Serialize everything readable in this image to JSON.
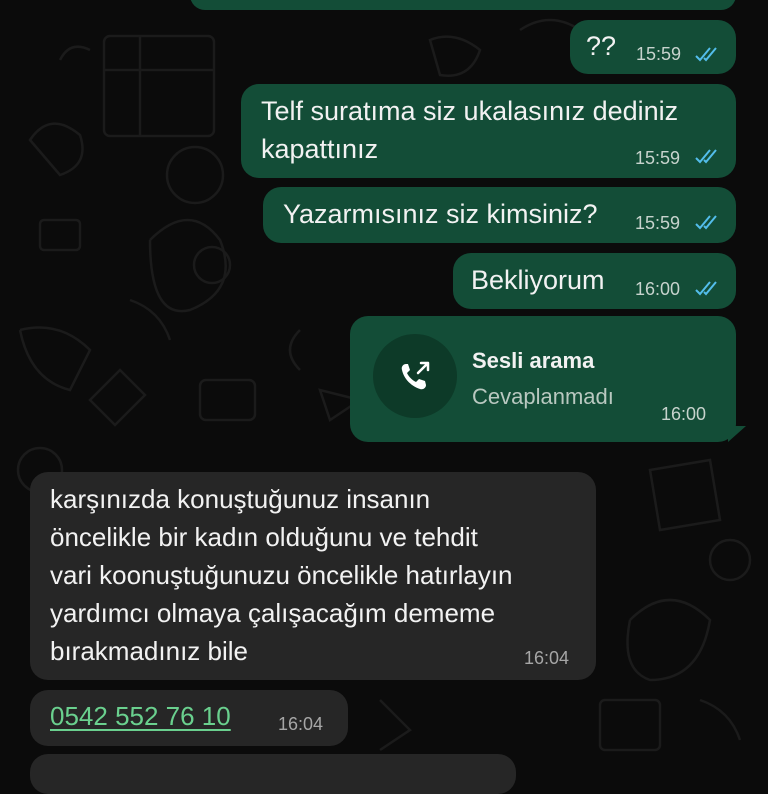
{
  "chat": {
    "messages": [
      {
        "text": "??",
        "time": "15:59",
        "direction": "outgoing",
        "status": "read"
      },
      {
        "text": "Telf suratıma siz ukalasınız dediniz\nkapattınız",
        "time": "15:59",
        "direction": "outgoing",
        "status": "read"
      },
      {
        "text": "Yazarmısınız siz kimsiniz?",
        "time": "15:59",
        "direction": "outgoing",
        "status": "read"
      },
      {
        "text": "Bekliyorum",
        "time": "16:00",
        "direction": "outgoing",
        "status": "read"
      },
      {
        "text": "karşınızda konuştuğunuz insanın\nöncelikle bir kadın olduğunu ve tehdit\nvari koonuştuğunuzu öncelikle hatırlayın\nyardımcı olmaya çalışacağım dememe\nbırakmadınız bile",
        "time": "16:04",
        "direction": "incoming"
      },
      {
        "text": "0542 552 76 10",
        "time": "16:04",
        "direction": "incoming",
        "link": true
      }
    ],
    "call": {
      "title": "Sesli arama",
      "status": "Cevaplanmadı",
      "time": "16:00",
      "icon": "outgoing-call-icon"
    }
  },
  "colors": {
    "outgoing_bubble": "#134d37",
    "incoming_bubble": "#262626",
    "read_ticks": "#53bdeb",
    "link": "#6ad08e"
  }
}
